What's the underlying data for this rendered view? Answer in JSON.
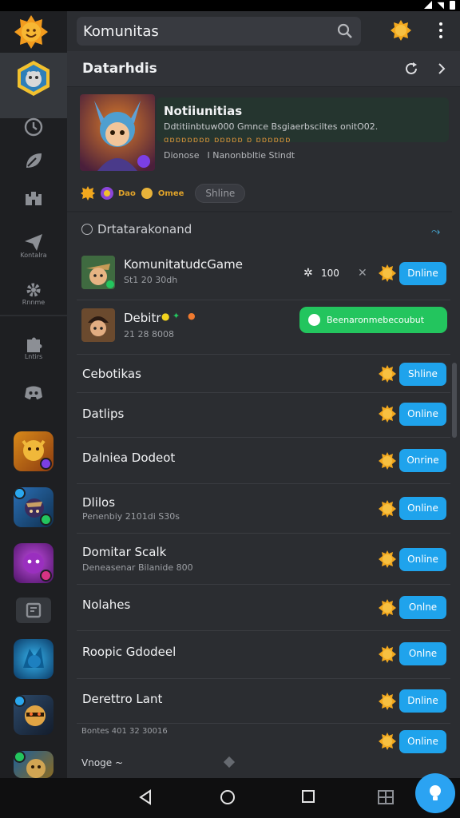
{
  "status": {
    "icons": [
      "signal-icon",
      "wifi-icon",
      "battery-icon"
    ]
  },
  "search": {
    "value": "Komunitas"
  },
  "header": {
    "title": "Datarhdis"
  },
  "featured": {
    "title": "Notiiunitias",
    "description": "Ddtitiinbtuw000 Gmnce Bsgiaerbsciltes onitO02.",
    "description2": "ɑɒɒɒɒɒɒɒ ɒɒɒɒɒ ɒ ɒɒɒɒɒɒ",
    "meta_left": "Dionose",
    "meta_right": "I Nanonbbltie Stindt",
    "badge_text": "Dao",
    "badge_text2": "Omee",
    "pill": "Shline"
  },
  "section": {
    "title": "Drtatarakonand"
  },
  "rows": [
    {
      "name": "KomunitatudcGame",
      "sub": "St1 20 30dh",
      "count": "100",
      "button": "Dnline"
    },
    {
      "name": "Debitr",
      "sub": "21 28 8008",
      "button": "Beenaronmebecoubut"
    },
    {
      "name": "Cebotikas",
      "button": "Shline"
    },
    {
      "name": "Datlips",
      "button": "Online"
    },
    {
      "name": "Dalniea Dodeot",
      "button": "Onrine"
    },
    {
      "name": "Dlilos",
      "sub": "Penenbiy 2101di S30s",
      "button": "Online"
    },
    {
      "name": "Domitar Scalk",
      "sub": "Deneasenar Bilanide 800",
      "button": "Online"
    },
    {
      "name": "Nolahes",
      "button": "Onlne"
    },
    {
      "name": "Roopic Gdodeel",
      "button": "Onlne"
    },
    {
      "name": "Derettro Lant",
      "button": "Dnline"
    }
  ],
  "footer": {
    "sub": "Bontes 401 32 30016",
    "label": "Vnoge",
    "last_button": "Online"
  },
  "rail": {
    "labels": [
      "Kontalra",
      "Rnnme",
      "Lntirs"
    ]
  },
  "colors": {
    "accent": "#1fa3ec",
    "green": "#23c55e",
    "bg": "#2b2d31",
    "rail": "#1e1f22"
  }
}
